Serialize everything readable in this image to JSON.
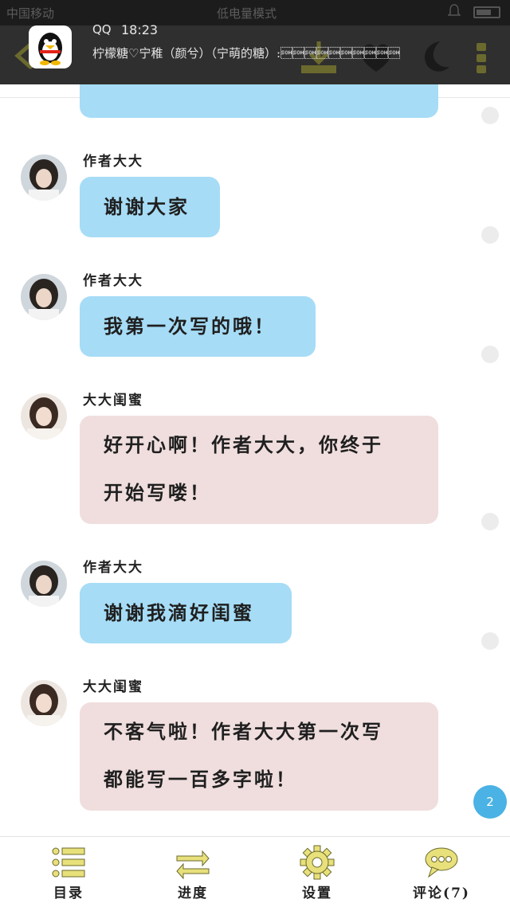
{
  "status_bar": {
    "carrier": "中国移动",
    "mode": "低电量模式"
  },
  "notification": {
    "app": "QQ",
    "time": "18:23",
    "message": "柠檬糖♡宁稚（颜兮）（宁萌的糖）:\u0001\u0001\u0001\u0001\u0001\u0001\u0001\u0001\u0001\u0001"
  },
  "messages": [
    {
      "sender": "作者大大",
      "lines": [
        "谢谢大家"
      ],
      "color": "blue"
    },
    {
      "sender": "作者大大",
      "lines": [
        "我第一次写的哦！"
      ],
      "color": "blue"
    },
    {
      "sender": "大大闺蜜",
      "lines": [
        "好开心啊！作者大大，你终于",
        "开始写喽！"
      ],
      "color": "pink"
    },
    {
      "sender": "作者大大",
      "lines": [
        "谢谢我滴好闺蜜"
      ],
      "color": "blue"
    },
    {
      "sender": "大大闺蜜",
      "lines": [
        "不客气啦！作者大大第一次写",
        "都能写一百多字啦！"
      ],
      "color": "pink"
    }
  ],
  "fab": {
    "count": "2"
  },
  "bottom_nav": [
    {
      "label": "目录",
      "icon": "list-icon"
    },
    {
      "label": "进度",
      "icon": "progress-arrows-icon"
    },
    {
      "label": "设置",
      "icon": "gear-icon"
    },
    {
      "label": "评论(7)",
      "icon": "comment-bubble-icon"
    }
  ],
  "colors": {
    "author_bubble": "#a6dcf6",
    "friend_bubble": "#f0dede",
    "icon_yellow": "#e8e07a",
    "fab": "#4ab2e4"
  }
}
